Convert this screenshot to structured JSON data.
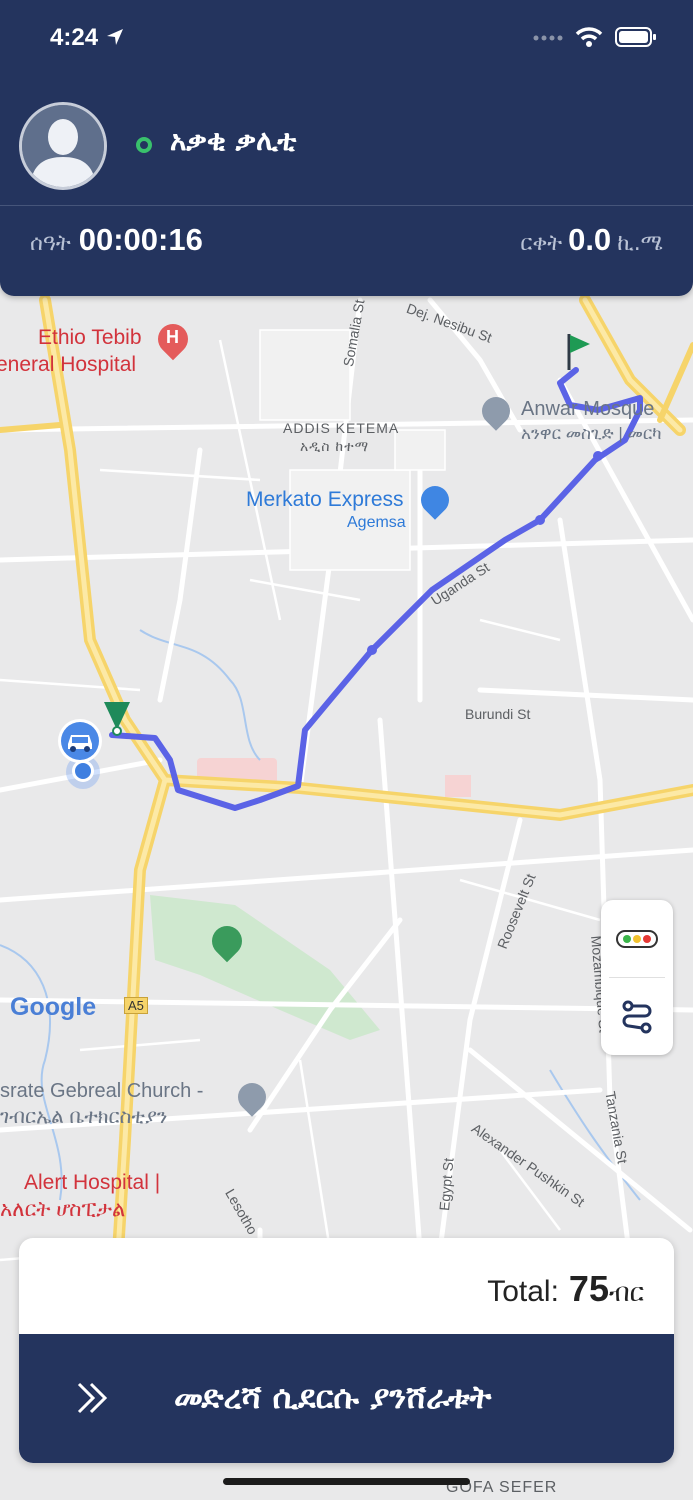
{
  "status_bar": {
    "time": "4:24",
    "icons": [
      "location-arrow-icon",
      "cellular-icon",
      "wifi-icon",
      "battery-icon"
    ]
  },
  "driver": {
    "name": "አቃቂ ቃሊቲ",
    "status": "online",
    "status_color": "#39c16c"
  },
  "trip": {
    "time_label": "ሰዓት",
    "time_value": "00:00:16",
    "distance_label": "ርቀት",
    "distance_value": "0.0",
    "distance_unit": "ኪ.ሜ"
  },
  "map": {
    "labels": {
      "ethio_tebib_1": "Ethio Tebib",
      "ethio_tebib_2": "eneral Hospital",
      "somalia_st": "Somalia St",
      "dej_nesibu": "Dej. Nesibu St",
      "anwar_mosque": "Anwar Mosque",
      "anwar_mosque_am": "አንዋር መስጊድ | መርካ",
      "addis_ketema": "ADDIS KETEMA",
      "addis_ketema_am": "አዲስ ከተማ",
      "merkato_express": "Merkato Express",
      "agemsa": "Agemsa",
      "uganda_st": "Uganda St",
      "burundi_st": "Burundi St",
      "roosevelt_st": "Roosevelt St",
      "mozambique_st": "Mozambique St",
      "a5": "A5",
      "google": "Google",
      "church": "srate Gebreal Church -",
      "church_am": "ገብርኤል ቤተክርስቲያን",
      "alert_hospital": "Alert Hospital |",
      "alert_hospital_am": "አለርት ሆስፒታል",
      "egypt_st": "Egypt St",
      "alexander_pushkin": "Alexander Pushkin St",
      "tanzania_st": "Tanzania St",
      "lesotho": "Lesotho",
      "gofa_sefer": "GOFA SEFER"
    },
    "route_color": "#5b63e6"
  },
  "controls": {
    "traffic_icon": "traffic-light-icon",
    "route_icon": "route-icon"
  },
  "fare": {
    "total_label": "Total:",
    "total_amount": "75",
    "currency": "ብር"
  },
  "action": {
    "label": "መድረሻ ሲደርሱ ያንሸራቱት",
    "icon": "double-chevron-right-icon"
  },
  "colors": {
    "header": "#24345e",
    "accent_online": "#39c16c"
  }
}
